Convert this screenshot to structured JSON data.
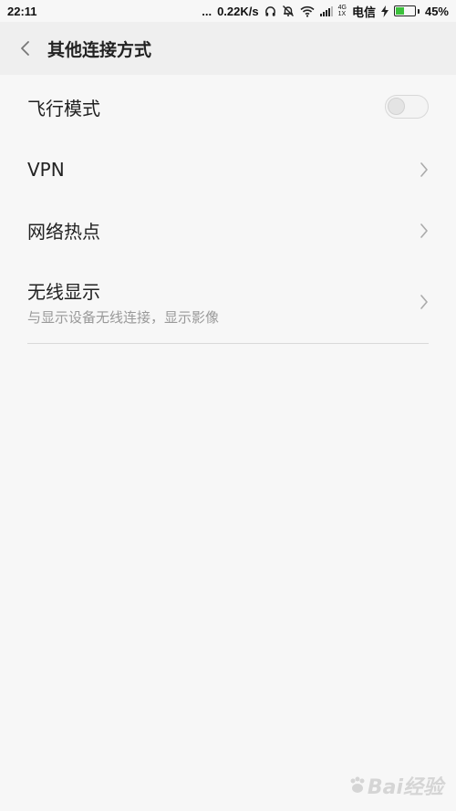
{
  "status_bar": {
    "time": "22:11",
    "dots": "...",
    "speed": "0.22K/s",
    "network_type_top": "4G",
    "network_type_bottom": "1X",
    "carrier": "电信",
    "battery_percent": "45%",
    "battery_level": 0.45,
    "battery_color": "#3bc13b"
  },
  "header": {
    "title": "其他连接方式"
  },
  "items": [
    {
      "label": "飞行模式",
      "control": "toggle",
      "toggle_on": false
    },
    {
      "label": "VPN",
      "control": "chevron"
    },
    {
      "label": "网络热点",
      "control": "chevron"
    },
    {
      "label": "无线显示",
      "sublabel": "与显示设备无线连接，显示影像",
      "control": "chevron"
    }
  ],
  "watermark": {
    "text": "Bai经验"
  }
}
